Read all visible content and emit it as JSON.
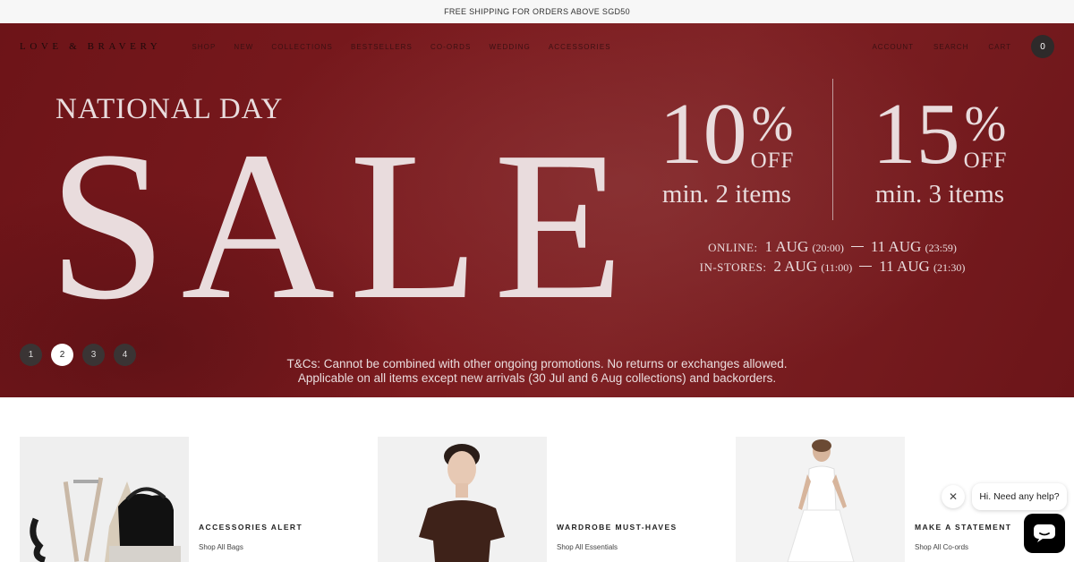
{
  "announcement": "FREE SHIPPING FOR ORDERS ABOVE SGD50",
  "nav": {
    "logo": "LOVE & BRAVERY",
    "menu": [
      "SHOP",
      "NEW",
      "COLLECTIONS",
      "BESTSELLERS",
      "CO-ORDS",
      "WEDDING",
      "ACCESSORIES"
    ],
    "utilities": [
      "ACCOUNT",
      "SEARCH",
      "CART"
    ],
    "cart_count": "0"
  },
  "hero": {
    "headline": "NATIONAL DAY",
    "sale": "SALE",
    "offers": [
      {
        "percent": "10",
        "symbol": "%",
        "off": "OFF",
        "min": "min. 2 items"
      },
      {
        "percent": "15",
        "symbol": "%",
        "off": "OFF",
        "min": "min. 3 items"
      }
    ],
    "online_label": "ONLINE:",
    "online_start": "1 AUG",
    "online_start_time": "(20:00)",
    "online_end": "11 AUG",
    "online_end_time": "(23:59)",
    "stores_label": "IN-STORES:",
    "stores_start": "2 AUG",
    "stores_start_time": "(11:00)",
    "stores_end": "11 AUG",
    "stores_end_time": "(21:30)",
    "tcs_line1": "T&Cs: Cannot be combined with other ongoing promotions. No returns or exchanges allowed.",
    "tcs_line2": "Applicable on all items except new arrivals (30 Jul and 6 Aug collections) and backorders.",
    "slides": [
      "1",
      "2",
      "3",
      "4"
    ],
    "active_slide": "2"
  },
  "collections": [
    {
      "title": "ACCESSORIES ALERT",
      "link": "Shop All Bags"
    },
    {
      "title": "WARDROBE MUST-HAVES",
      "link": "Shop All Essentials"
    },
    {
      "title": "MAKE A STATEMENT",
      "link": "Shop All Co-ords"
    }
  ],
  "chat": {
    "greeting": "Hi. Need any help?"
  },
  "colors": {
    "hero_red": "#7c1b1f",
    "hero_text": "#e9dcdd"
  }
}
